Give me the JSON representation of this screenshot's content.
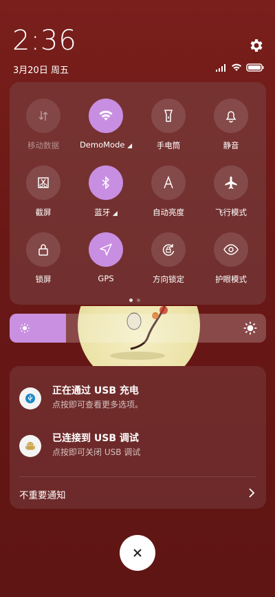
{
  "status": {
    "time": "2:36",
    "date": "3月20日 周五"
  },
  "quick_settings": {
    "tiles": [
      {
        "label": "移动数据",
        "icon": "mobile-data-icon",
        "state": "disabled"
      },
      {
        "label": "DemoMode",
        "icon": "wifi-icon",
        "state": "on",
        "has_sub_indicator": true
      },
      {
        "label": "手电筒",
        "icon": "flashlight-icon",
        "state": "off"
      },
      {
        "label": "静音",
        "icon": "bell-icon",
        "state": "off"
      },
      {
        "label": "截屏",
        "icon": "screenshot-icon",
        "state": "off"
      },
      {
        "label": "蓝牙",
        "icon": "bluetooth-icon",
        "state": "on",
        "has_sub_indicator": true
      },
      {
        "label": "自动亮度",
        "icon": "auto-brightness-icon",
        "state": "off"
      },
      {
        "label": "飞行模式",
        "icon": "airplane-icon",
        "state": "off"
      },
      {
        "label": "锁屏",
        "icon": "lock-icon",
        "state": "off"
      },
      {
        "label": "GPS",
        "icon": "location-icon",
        "state": "on"
      },
      {
        "label": "方向锁定",
        "icon": "rotation-lock-icon",
        "state": "off"
      },
      {
        "label": "护眼模式",
        "icon": "eye-icon",
        "state": "off"
      }
    ],
    "page_count": 2,
    "current_page": 1
  },
  "brightness": {
    "level": 0.22
  },
  "notifications": {
    "items": [
      {
        "title": "正在通过 USB 充电",
        "desc": "点按即可查看更多选项。",
        "icon": "usb-icon"
      },
      {
        "title": "已连接到 USB 调试",
        "desc": "点按即可关闭 USB 调试",
        "icon": "android-icon"
      }
    ],
    "less_important_label": "不重要通知"
  },
  "colors": {
    "accent": "#c88ee2",
    "background": "#6b1a18"
  }
}
